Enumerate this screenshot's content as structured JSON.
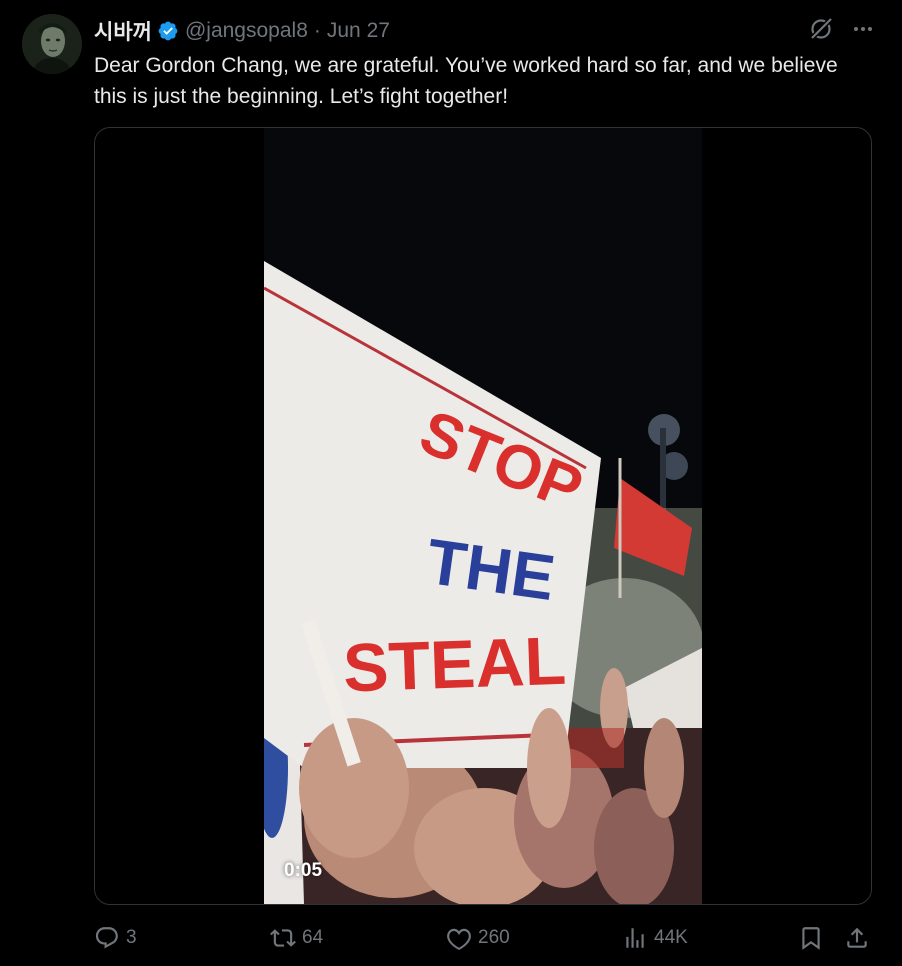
{
  "author": {
    "display_name": "시바꺼",
    "handle": "@jangsopal8",
    "separator": "·",
    "date": "Jun 27",
    "verified": true
  },
  "tweet": {
    "text": "Dear Gordon Chang, we are grateful. You’ve worked hard so far, and we believe this is just the beginning. Let’s fight together!"
  },
  "media": {
    "type": "video",
    "timestamp": "0:05",
    "sign_lines": [
      "STOP",
      "THE",
      "STEAL"
    ]
  },
  "metrics": {
    "replies": "3",
    "reposts": "64",
    "likes": "260",
    "views": "44K"
  },
  "icons": {
    "verified": "verified-badge-icon",
    "grok": "grok-icon",
    "more": "more-icon",
    "reply": "reply-icon",
    "repost": "repost-icon",
    "like": "heart-icon",
    "views": "views-icon",
    "bookmark": "bookmark-icon",
    "share": "share-icon"
  },
  "colors": {
    "background": "#000000",
    "text_primary": "#e7e9ea",
    "text_secondary": "#71767b",
    "verified_blue": "#1d9bf0",
    "media_border": "#2f3336",
    "sign_red": "#d9302e",
    "sign_blue": "#2a3f9a"
  }
}
